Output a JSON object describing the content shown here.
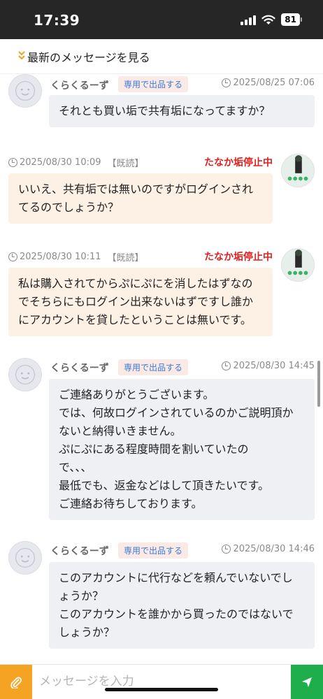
{
  "status_bar": {
    "time": "17:39",
    "battery": "81"
  },
  "latest_link": {
    "label": "最新のメッセージを見る"
  },
  "messages": [
    {
      "sender": "くらくるーず",
      "badge": "専用で出品する",
      "timestamp": "2025/08/25 07:06",
      "lines": [
        "それとも買い垢で共有垢になってますか？"
      ]
    },
    {
      "timestamp": "2025/08/30 10:09",
      "read": "【既読】",
      "status": "たなか垢停止中",
      "lines": [
        "いいえ、共有垢では無いのですがログインされ",
        "てるのでしょうか？"
      ]
    },
    {
      "timestamp": "2025/08/30 10:11",
      "read": "【既読】",
      "status": "たなか垢停止中",
      "lines": [
        "私は購入されてからぷにぷにを消したはずなの",
        "でそちらにもログイン出来ないはずですし誰か",
        "にアカウントを貸したということは無いです。"
      ]
    },
    {
      "sender": "くらくるーず",
      "badge": "専用で出品する",
      "timestamp": "2025/08/30 14:45",
      "lines": [
        "ご連絡ありがとうございます。",
        "では、何故ログインされているのかご説明頂か",
        "ないと納得いきません。",
        "ぷにぷにある程度時間を割いていたの",
        "で、、、",
        "最低でも、返金などはして頂きたいです。",
        "ご連絡お待ちしております。"
      ]
    },
    {
      "sender": "くらくるーず",
      "badge": "専用で出品する",
      "timestamp": "2025/08/30 14:46",
      "lines": [
        "このアカウントに代行などを頼んでいないでし",
        "ょうか？",
        "このアカウントを誰かから買ったのではないで",
        "しょうか？"
      ]
    }
  ],
  "input": {
    "placeholder": "メッセージを入力"
  },
  "icons": {
    "attach": "paperclip-icon",
    "send": "send-icon"
  },
  "colors": {
    "accent_orange": "#f4a323",
    "send_green": "#1fae4c",
    "warning_red": "#e02020",
    "badge_blue": "#3a7bd5"
  }
}
